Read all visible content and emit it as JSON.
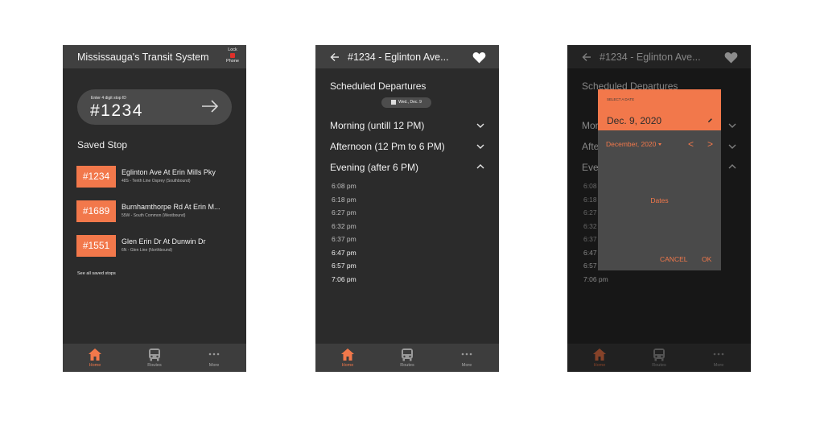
{
  "colors": {
    "accent": "#f2784b",
    "phone_bg": "#2b2b2b",
    "bar_bg": "#404040",
    "lock_dot": "#e0302a"
  },
  "home": {
    "title": "Mississauga's Transit System",
    "lock_label_1": "Lock",
    "lock_label_2": "Phone",
    "input_hint": "Enter 4 digit stop ID",
    "input_value": "#1234",
    "saved_heading": "Saved Stop",
    "saved": [
      {
        "id": "#1234",
        "name": "Eglinton Ave At Erin Mills Pky",
        "route": "48S - Tenth Line Osprey (Southbound)"
      },
      {
        "id": "#1689",
        "name": "Burnhamthorpe Rd At Erin M...",
        "route": "55W - South Common (Westbound)"
      },
      {
        "id": "#1551",
        "name": "Glen Erin Dr At Dunwin Dr",
        "route": "6N - Glen Line (Northbound)"
      }
    ],
    "see_all": "See all saved stops"
  },
  "nav": {
    "home": "Home",
    "routes": "Routes",
    "more": "More"
  },
  "departures": {
    "title": "#1234 - Eglinton Ave...",
    "heading": "Scheduled Departures",
    "date_chip": "Wed., Dec. 9",
    "periods": [
      "Morning (untill 12 PM)",
      "Afternoon (12 Pm to 6 PM)",
      "Evening (after 6 PM)"
    ],
    "times": [
      "6:08 pm",
      "6:18 pm",
      "6:27 pm",
      "6:32 pm",
      "6:37 pm",
      "6:47 pm",
      "6:57 pm",
      "7:06 pm"
    ]
  },
  "picker": {
    "background_visible": {
      "periods_short": [
        "Mor",
        "Afte",
        "Eve"
      ],
      "times_short": [
        "6:08",
        "6:18",
        "6:27",
        "6:32",
        "6:37",
        "6:47",
        "6:57",
        "7:06 pm"
      ]
    },
    "select_label": "SELECT A DATE",
    "selected_date": "Dec. 9, 2020",
    "month_label": "December, 2020",
    "prev": "<",
    "next": ">",
    "dates_placeholder": "Dates",
    "cancel": "CANCEL",
    "ok": "OK"
  }
}
